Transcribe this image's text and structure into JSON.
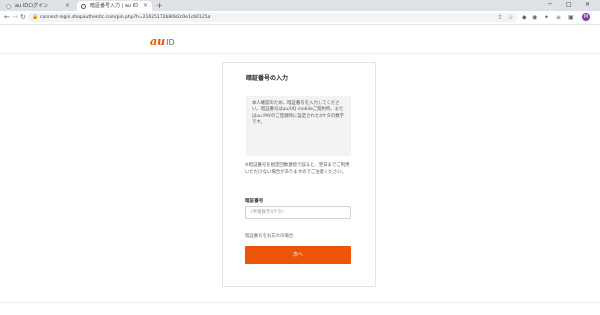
{
  "browser": {
    "tabs": [
      {
        "title": "au IDログイン",
        "active": false,
        "close": "×"
      },
      {
        "title": "暗証番号入力 | au ID",
        "active": true,
        "close": "×"
      }
    ],
    "new_tab": "+",
    "window_controls": {
      "minimize": "─",
      "maximize": "□",
      "close": "✕"
    },
    "nav": {
      "back": "←",
      "forward": "→",
      "reload": "↻"
    },
    "url": "connect-login.shopauthentic.com/pin.php?h=21625172b8082c0e1c60125a",
    "profile_initial": "M"
  },
  "site": {
    "logo_au": "au",
    "logo_id": "ID",
    "brand_color": "#eb5505"
  },
  "form": {
    "title": "暗証番号の入力",
    "info_text": "本人確認のため、暗証番号を入力してください。暗証番号はau/UQ mobileご契約時、またはau PAYのご登録時に設定された4ケタの数字です。",
    "notice_text": "※暗証番号を規定回数連続で誤ると、翌日までご利用いただけない場合がありますのでご注意ください。",
    "pin_label": "暗証番号",
    "pin_placeholder": "(半角数字4ケタ)",
    "forgot_link": "暗証番号をお忘れの場合",
    "submit_label": "次へ"
  }
}
